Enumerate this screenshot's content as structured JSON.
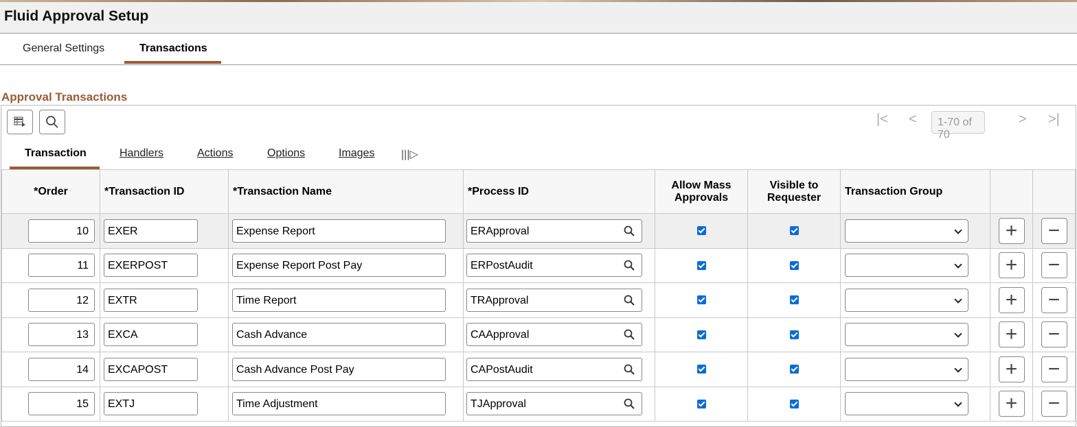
{
  "header": {
    "title": "Fluid Approval Setup"
  },
  "page_tabs": [
    {
      "label": "General Settings"
    },
    {
      "label": "Transactions"
    }
  ],
  "section_title": "Approval Transactions",
  "pager": {
    "range": "1-70 of 70"
  },
  "grid_tabs": [
    {
      "label": "Transaction"
    },
    {
      "label": "Handlers"
    },
    {
      "label": "Actions"
    },
    {
      "label": "Options"
    },
    {
      "label": "Images"
    }
  ],
  "columns": [
    "*Order",
    "*Transaction ID",
    "*Transaction Name",
    "*Process ID",
    "Allow Mass Approvals",
    "Visible to Requester",
    "Transaction Group"
  ],
  "rows": [
    {
      "order": "10",
      "id": "EXER",
      "name": "Expense Report",
      "process": "ERApproval",
      "mass": true,
      "visible": true,
      "group": ""
    },
    {
      "order": "11",
      "id": "EXERPOST",
      "name": "Expense Report Post Pay",
      "process": "ERPostAudit",
      "mass": true,
      "visible": true,
      "group": ""
    },
    {
      "order": "12",
      "id": "EXTR",
      "name": "Time Report",
      "process": "TRApproval",
      "mass": true,
      "visible": true,
      "group": ""
    },
    {
      "order": "13",
      "id": "EXCA",
      "name": "Cash Advance",
      "process": "CAApproval",
      "mass": true,
      "visible": true,
      "group": ""
    },
    {
      "order": "14",
      "id": "EXCAPOST",
      "name": "Cash Advance Post Pay",
      "process": "CAPostAudit",
      "mass": true,
      "visible": true,
      "group": ""
    },
    {
      "order": "15",
      "id": "EXTJ",
      "name": "Time Adjustment",
      "process": "TJApproval",
      "mass": true,
      "visible": true,
      "group": ""
    }
  ],
  "colors": {
    "accent": "#9b5a34",
    "checkbox": "#0b6cd6"
  }
}
